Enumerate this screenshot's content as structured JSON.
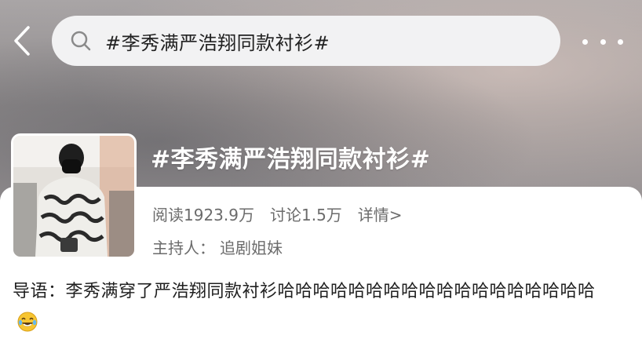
{
  "header": {
    "search_text": "#李秀满严浩翔同款衬衫#"
  },
  "topic": {
    "title": "#李秀满严浩翔同款衬衫#",
    "reads": "阅读1923.9万",
    "discussions": "讨论1.5万",
    "details_link": "详情>",
    "host_label": "主持人：",
    "host_name": "追剧姐妹"
  },
  "intro": {
    "label": "导语：",
    "text": "李秀满穿了严浩翔同款衬衫哈哈哈哈哈哈哈哈哈哈哈哈哈哈哈哈哈哈",
    "emoji": "laughing-crying-emoji"
  },
  "colors": {
    "header_bg": "#9a9597",
    "search_bg": "#f2f2f3",
    "muted_text": "#6b6b6b",
    "main_text": "#1f1f1f"
  }
}
